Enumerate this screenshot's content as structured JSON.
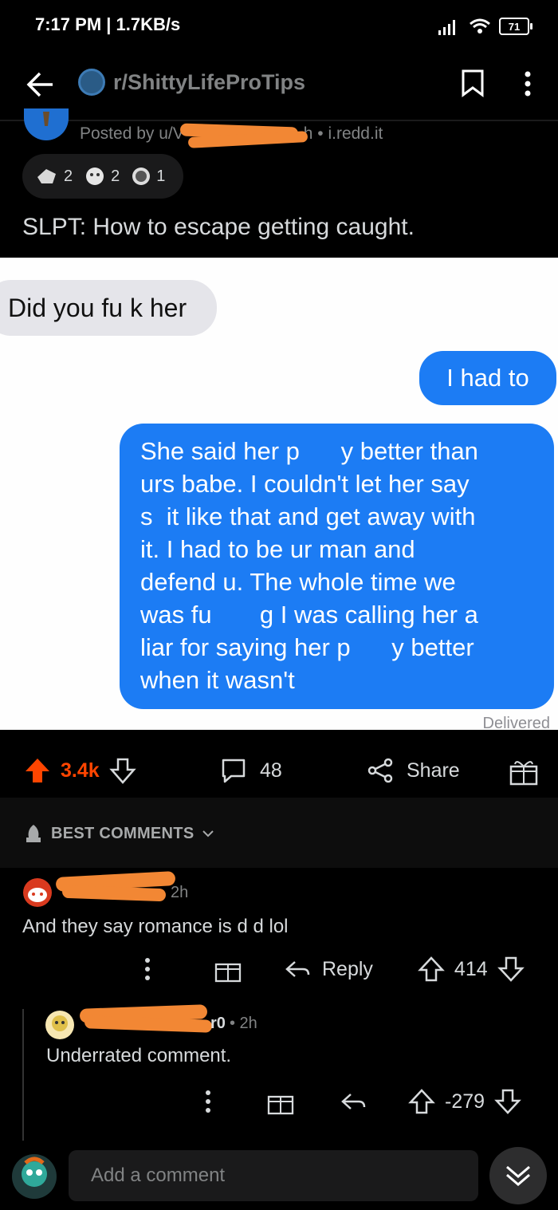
{
  "status_bar": {
    "time": "7:17 PM | 1.7KB/s",
    "battery": "71"
  },
  "header": {
    "subreddit": "r/ShittyLifeProTips",
    "icons": [
      "back-arrow-icon",
      "bookmark-icon",
      "more-vertical-icon"
    ]
  },
  "post": {
    "posted_by_prefix": "Posted by u/V",
    "age_source": "h • i.redd.it",
    "awards": [
      {
        "icon": "hand-award-icon",
        "count": "2"
      },
      {
        "icon": "wholesome-award-icon",
        "count": "2"
      },
      {
        "icon": "silver-award-icon",
        "count": "1"
      }
    ],
    "title": "SLPT: How to escape getting caught."
  },
  "image": {
    "incoming": "Did you fu  k her",
    "outgoing_1": "I had to",
    "outgoing_2_lines": [
      "She said her p      y better than",
      "urs babe. I couldn't let her say",
      "s  it like that and get away with",
      "it. I had to be ur man and",
      "defend u. The whole time we",
      "was fu       g I was calling her a",
      "liar for saying her p      y better",
      "when it wasn't"
    ],
    "delivered": "Delivered"
  },
  "action_bar": {
    "votes": "3.4k",
    "comments": "48",
    "share": "Share"
  },
  "sort": {
    "label": "BEST COMMENTS"
  },
  "comments": [
    {
      "age": "2h",
      "body": "And they say romance is d    d lol",
      "reply": "Reply",
      "votes": "414"
    },
    {
      "author_suffix": "r0",
      "age": "• 2h",
      "body": "Underrated comment.",
      "votes": "-279"
    }
  ],
  "composer": {
    "placeholder": "Add a comment"
  },
  "colors": {
    "upvote": "#ff4500",
    "bubble_blue": "#1c7cf4",
    "redaction": "#f28734"
  }
}
